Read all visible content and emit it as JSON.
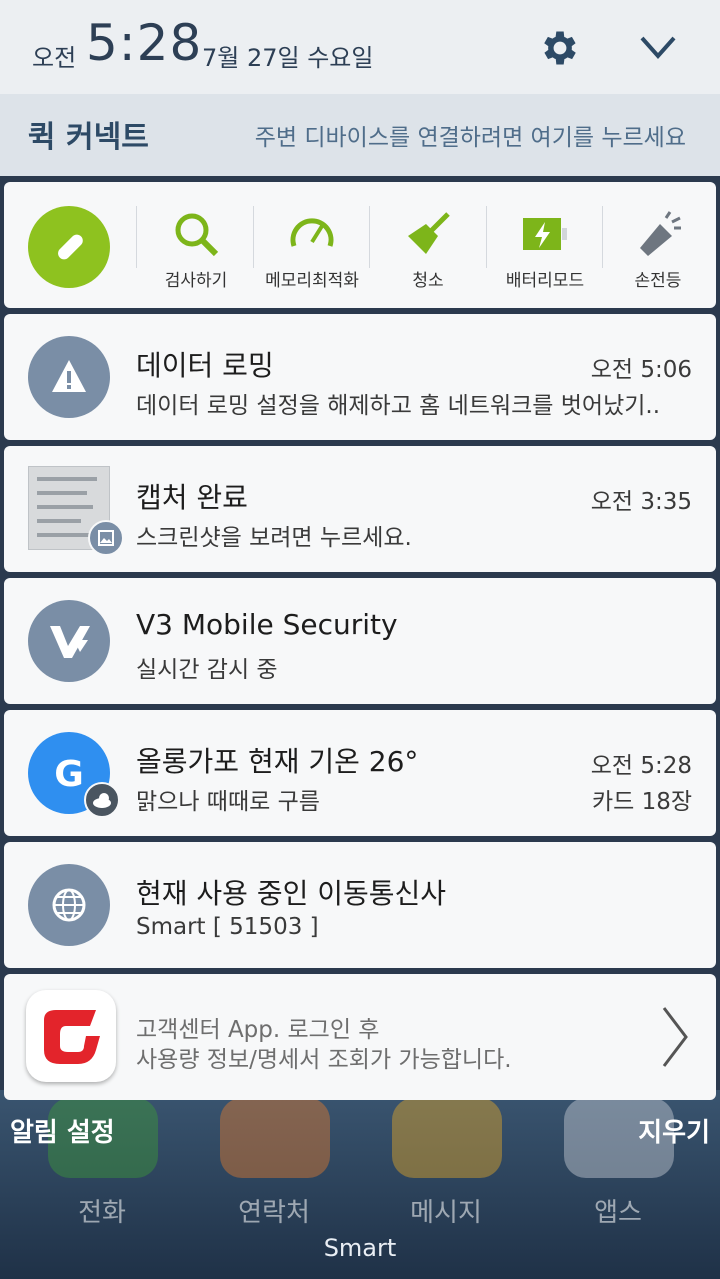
{
  "status": {
    "ampm": "오전",
    "time": "5:28",
    "date": "7월 27일 수요일"
  },
  "quick_connect": {
    "title": "퀵 커넥트",
    "hint": "주변 디바이스를 연결하려면 여기를 누르세요"
  },
  "tools": {
    "items": [
      {
        "label": "검사하기",
        "icon": "search-icon"
      },
      {
        "label": "메모리최적화",
        "icon": "gauge-icon"
      },
      {
        "label": "청소",
        "icon": "broom-icon"
      },
      {
        "label": "배터리모드",
        "icon": "battery-icon"
      },
      {
        "label": "손전등",
        "icon": "flashlight-icon"
      }
    ],
    "accent": "#8ec21f"
  },
  "notifications": [
    {
      "title": "데이터 로밍",
      "subtitle": "데이터 로밍 설정을 해제하고 홈 네트워크를 벗어났기..",
      "time": "오전 5:06",
      "icon": "warning-icon"
    },
    {
      "title": "캡처 완료",
      "subtitle": "스크린샷을 보려면 누르세요.",
      "time": "오전 3:35",
      "icon": "image-icon"
    },
    {
      "title": "V3 Mobile Security",
      "subtitle": "실시간 감시 중",
      "time": "",
      "icon": "v3-icon"
    },
    {
      "title": "올롱가포 현재 기온 26°",
      "subtitle": "맑으나 때때로 구름",
      "time": "오전 5:28",
      "extra": "카드 18장",
      "icon": "google-icon"
    },
    {
      "title": "현재 사용 중인 이동통신사",
      "subtitle": "Smart [ 51503 ]",
      "time": "",
      "icon": "globe-icon"
    }
  ],
  "promo": {
    "line1": "고객센터 App. 로그인 후",
    "line2": "사용량 정보/명세서 조회가 가능합니다."
  },
  "bottom": {
    "left": "알림 설정",
    "right": "지우기"
  },
  "dock": {
    "apps": [
      "전화",
      "연락처",
      "메시지",
      "앱스"
    ],
    "carrier": "Smart"
  }
}
